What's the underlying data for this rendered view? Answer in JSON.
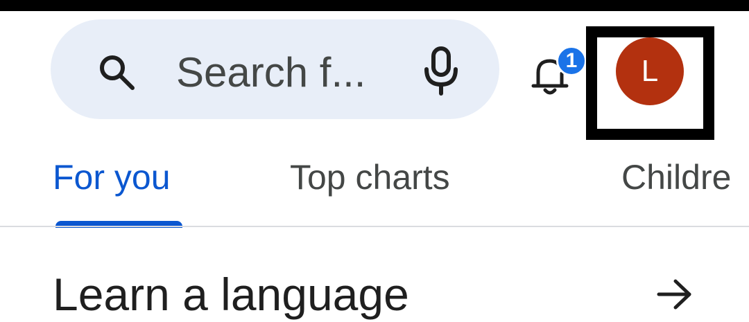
{
  "search": {
    "placeholder": "Search f..."
  },
  "notifications": {
    "badge_count": "1"
  },
  "account": {
    "avatar_initial": "L",
    "avatar_color": "#b3310f"
  },
  "tabs": [
    {
      "label": "For you",
      "selected": true
    },
    {
      "label": "Top charts",
      "selected": false
    },
    {
      "label": "Childre",
      "selected": false
    }
  ],
  "section": {
    "title": "Learn a language"
  },
  "icons": [
    "search-icon",
    "mic-icon",
    "bell-icon",
    "arrow-right-icon"
  ],
  "colors": {
    "accent": "#0b57d0",
    "search_background": "#e8eef8",
    "badge": "#1a73e8"
  }
}
